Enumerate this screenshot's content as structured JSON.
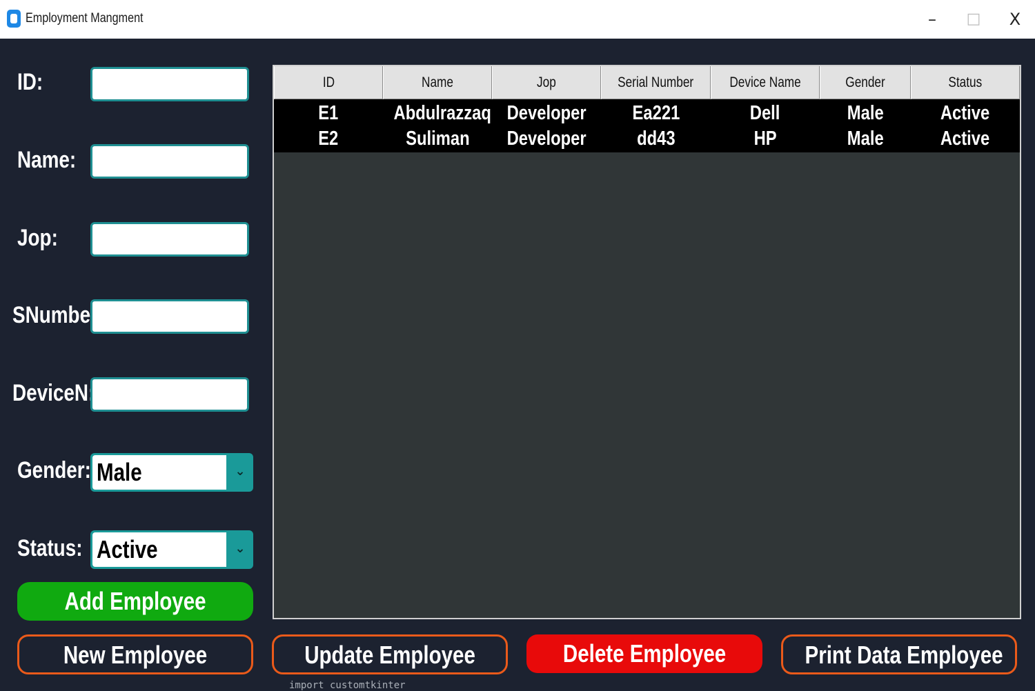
{
  "window": {
    "title": "Employment Mangment",
    "minimize": "–",
    "maximize": "□",
    "close": "X"
  },
  "form": {
    "id_label": "ID:",
    "id_value": "",
    "name_label": "Name:",
    "name_value": "",
    "job_label": "Jop:",
    "job_value": "",
    "snumber_label": "SNumber",
    "snumber_value": "",
    "device_label": "DeviceN:",
    "device_value": "",
    "gender_label": "Gender:",
    "gender_value": "Male",
    "status_label": "Status:",
    "status_value": "Active",
    "dropdown_icon": "chevron-down-icon"
  },
  "buttons": {
    "add": "Add Employee",
    "new": "New Employee",
    "update": "Update Employee",
    "delete": "Delete Employee",
    "print": "Print Data Employee"
  },
  "table": {
    "columns": [
      "ID",
      "Name",
      "Jop",
      "Serial Number",
      "Device Name",
      "Gender",
      "Status"
    ],
    "rows": [
      [
        "E1",
        "Abdulrazzaq",
        "Developer",
        "Ea221",
        "Dell",
        "Male",
        "Active"
      ],
      [
        "E2",
        "Suliman",
        "Developer",
        "dd43",
        "HP",
        "Male",
        "Active"
      ]
    ]
  },
  "background_code_text": "import customtkinter",
  "colors": {
    "background": "#1c2230",
    "accent_teal": "#1a9a99",
    "add_green": "#10aa10",
    "delete_red": "#e80a0a",
    "outline_orange": "#ea5a1a"
  }
}
